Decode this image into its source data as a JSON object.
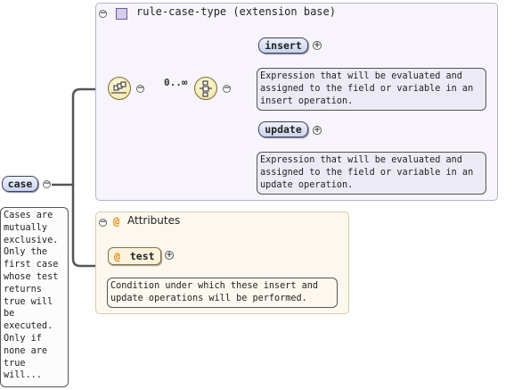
{
  "root": {
    "label": "case",
    "doc_lines": [
      "Cases are",
      "mutually",
      "exclusive.",
      "Only the",
      "first case",
      "whose test",
      "returns",
      "true will",
      "be",
      "executed.",
      "Only if",
      "none are",
      "true",
      "will..."
    ]
  },
  "type_panel": {
    "title": "rule-case-type (extension base)",
    "cardinality": "0..∞",
    "elements": [
      {
        "label": "insert",
        "doc_lines": [
          "Expression that will be evaluated and",
          "assigned to the field or variable in an",
          "insert operation."
        ]
      },
      {
        "label": "update",
        "doc_lines": [
          "Expression that will be evaluated and",
          "assigned to the field or variable in an",
          "update operation."
        ]
      }
    ]
  },
  "attributes_panel": {
    "title": "Attributes",
    "attribute": {
      "label": "test",
      "doc_lines": [
        "Condition under which these insert and",
        "update operations will be performed."
      ]
    }
  },
  "glyphs": {
    "collapse": "−",
    "expand": "+",
    "at": "@"
  },
  "colors": {
    "type_panel_bg": "#f7f5fb",
    "attr_panel_bg": "#fcf8ef",
    "element_fill": "#c9d3ec",
    "attr_marker": "#e08a12"
  }
}
